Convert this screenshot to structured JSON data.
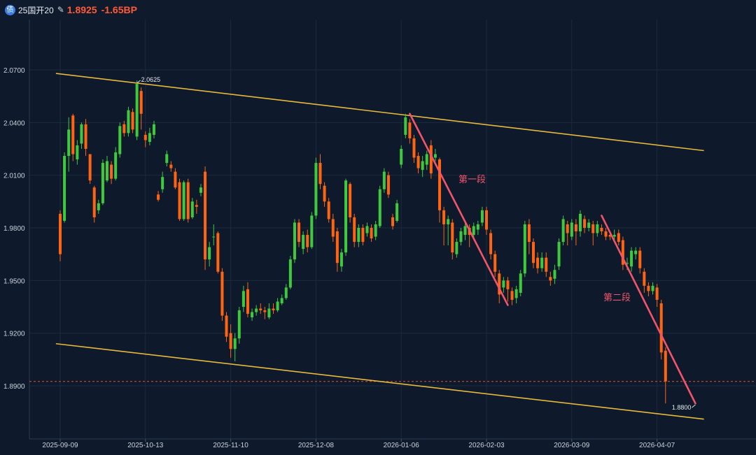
{
  "header": {
    "icon_glyph": "债",
    "bond_name": "25国开20",
    "price": "1.8925",
    "change": "-1.65BP",
    "accent": "#ff5a36"
  },
  "colors": {
    "background": "#0e1a2b",
    "grid": "#1b2a3e",
    "up": "#3ec93e",
    "down": "#ff6412",
    "channel": "#e6b93a",
    "trend": "#f2556b",
    "current_line": "#e0552f",
    "axis_text": "#c9d1dc"
  },
  "chart_data": {
    "type": "candlestick",
    "ylim": [
      1.863,
      2.094
    ],
    "yticks": [
      {
        "value": 2.07,
        "label": "2.0700"
      },
      {
        "value": 2.04,
        "label": "2.0400"
      },
      {
        "value": 2.01,
        "label": "2.0100"
      },
      {
        "value": 1.98,
        "label": "1.9800"
      },
      {
        "value": 1.95,
        "label": "1.9500"
      },
      {
        "value": 1.92,
        "label": "1.9200"
      },
      {
        "value": 1.89,
        "label": "1.8900"
      }
    ],
    "xticks": [
      {
        "index": 0,
        "label": "2025-09-09"
      },
      {
        "index": 20,
        "label": "2025-10-13"
      },
      {
        "index": 40,
        "label": "2025-11-10"
      },
      {
        "index": 60,
        "label": "2025-12-08"
      },
      {
        "index": 80,
        "label": "2026-01-06"
      },
      {
        "index": 100,
        "label": "2026-02-03"
      },
      {
        "index": 120,
        "label": "2026-03-09"
      },
      {
        "index": 140,
        "label": "2026-04-07"
      }
    ],
    "x_count": 151,
    "candles": [
      [
        1.988,
        1.965,
        1.99,
        1.961
      ],
      [
        1.984,
        2.021,
        2.023,
        1.983
      ],
      [
        2.021,
        2.036,
        2.043,
        2.012
      ],
      [
        2.044,
        2.022,
        2.045,
        2.018
      ],
      [
        2.019,
        2.027,
        2.03,
        2.016
      ],
      [
        2.028,
        2.039,
        2.04,
        2.025
      ],
      [
        2.039,
        2.025,
        2.042,
        2.021
      ],
      [
        2.022,
        2.007,
        2.022,
        2.005
      ],
      [
        2.003,
        1.986,
        2.004,
        1.983
      ],
      [
        1.99,
        1.994,
        1.996,
        1.988
      ],
      [
        1.994,
        2.017,
        2.019,
        1.993
      ],
      [
        2.007,
        2.018,
        2.021,
        2.006
      ],
      [
        2.016,
        2.008,
        2.018,
        2.005
      ],
      [
        2.008,
        2.023,
        2.026,
        2.007
      ],
      [
        2.022,
        2.038,
        2.04,
        2.02
      ],
      [
        2.039,
        2.034,
        2.041,
        2.032
      ],
      [
        2.034,
        2.047,
        2.049,
        2.032
      ],
      [
        2.046,
        2.036,
        2.048,
        2.034
      ],
      [
        2.032,
        2.062,
        2.064,
        2.03
      ],
      [
        2.058,
        2.045,
        2.06,
        2.036
      ],
      [
        2.033,
        2.03,
        2.035,
        2.026
      ],
      [
        2.029,
        2.034,
        2.037,
        2.027
      ],
      [
        2.033,
        2.039,
        2.041,
        2.031
      ],
      [
        1.999,
        1.996,
        2.001,
        1.995
      ],
      [
        2.002,
        2.009,
        2.012,
        2.0
      ],
      [
        2.017,
        2.022,
        2.024,
        2.015
      ],
      [
        2.016,
        2.014,
        2.018,
        2.012
      ],
      [
        2.012,
        2.003,
        2.014,
        2.002
      ],
      [
        2.006,
        1.985,
        2.008,
        1.984
      ],
      [
        1.985,
        2.006,
        2.007,
        1.984
      ],
      [
        2.006,
        1.985,
        2.008,
        1.983
      ],
      [
        1.986,
        1.995,
        1.997,
        1.985
      ],
      [
        1.993,
        1.992,
        1.996,
        1.988
      ],
      [
        2.0,
        2.003,
        2.005,
        1.998
      ],
      [
        2.012,
        1.962,
        2.015,
        1.956
      ],
      [
        1.962,
        1.969,
        1.972,
        1.958
      ],
      [
        1.975,
        1.975,
        1.982,
        1.97
      ],
      [
        1.977,
        1.955,
        1.978,
        1.954
      ],
      [
        1.955,
        1.93,
        1.957,
        1.927
      ],
      [
        1.93,
        1.918,
        1.932,
        1.915
      ],
      [
        1.92,
        1.911,
        1.925,
        1.906
      ],
      [
        1.911,
        1.917,
        1.92,
        1.904
      ],
      [
        1.917,
        1.933,
        1.935,
        1.914
      ],
      [
        1.935,
        1.944,
        1.947,
        1.932
      ],
      [
        1.945,
        1.931,
        1.949,
        1.929
      ],
      [
        1.929,
        1.932,
        1.934,
        1.927
      ],
      [
        1.932,
        1.934,
        1.936,
        1.93
      ],
      [
        1.934,
        1.933,
        1.937,
        1.931
      ],
      [
        1.933,
        1.932,
        1.935,
        1.928
      ],
      [
        1.929,
        1.934,
        1.937,
        1.928
      ],
      [
        1.934,
        1.933,
        1.937,
        1.931
      ],
      [
        1.933,
        1.938,
        1.94,
        1.932
      ],
      [
        1.937,
        1.94,
        1.942,
        1.936
      ],
      [
        1.94,
        1.946,
        1.948,
        1.939
      ],
      [
        1.946,
        1.962,
        1.964,
        1.945
      ],
      [
        1.962,
        1.983,
        1.985,
        1.96
      ],
      [
        1.983,
        1.972,
        1.985,
        1.969
      ],
      [
        1.968,
        1.976,
        1.978,
        1.965
      ],
      [
        1.976,
        1.969,
        1.979,
        1.966
      ],
      [
        1.969,
        1.987,
        1.989,
        1.968
      ],
      [
        1.987,
        2.017,
        2.02,
        1.985
      ],
      [
        2.017,
        2.005,
        2.022,
        2.002
      ],
      [
        2.004,
        1.995,
        2.006,
        1.992
      ],
      [
        1.995,
        1.985,
        1.997,
        1.983
      ],
      [
        1.985,
        1.975,
        1.988,
        1.972
      ],
      [
        1.978,
        1.96,
        1.98,
        1.955
      ],
      [
        1.958,
        1.966,
        1.968,
        1.955
      ],
      [
        1.966,
        2.007,
        2.008,
        1.964
      ],
      [
        2.005,
        1.986,
        2.006,
        1.983
      ],
      [
        1.986,
        1.972,
        1.988,
        1.969
      ],
      [
        1.972,
        1.98,
        1.982,
        1.969
      ],
      [
        1.98,
        1.972,
        1.982,
        1.97
      ],
      [
        1.977,
        1.981,
        1.983,
        1.975
      ],
      [
        1.98,
        1.974,
        1.982,
        1.972
      ],
      [
        1.975,
        1.982,
        1.984,
        1.973
      ],
      [
        1.981,
        2.002,
        2.004,
        1.98
      ],
      [
        2.002,
        2.012,
        2.014,
        2.0
      ],
      [
        2.01,
        1.999,
        2.012,
        1.997
      ],
      [
        1.986,
        1.981,
        1.988,
        1.979
      ],
      [
        1.984,
        1.994,
        1.996,
        1.983
      ],
      [
        2.016,
        2.025,
        2.027,
        2.014
      ],
      [
        2.033,
        2.043,
        2.045,
        2.031
      ],
      [
        2.04,
        2.031,
        2.042,
        2.028
      ],
      [
        2.031,
        2.02,
        2.033,
        2.017
      ],
      [
        2.021,
        2.014,
        2.023,
        2.011
      ],
      [
        2.013,
        2.018,
        2.021,
        2.009
      ],
      [
        2.016,
        2.022,
        2.024,
        2.013
      ],
      [
        2.027,
        2.011,
        2.03,
        2.008
      ],
      [
        2.02,
        2.022,
        2.025,
        2.018
      ],
      [
        2.019,
        1.99,
        2.02,
        1.983
      ],
      [
        1.99,
        1.982,
        1.992,
        1.97
      ],
      [
        1.982,
        1.985,
        1.987,
        1.97
      ],
      [
        1.983,
        1.966,
        1.985,
        1.962
      ],
      [
        1.965,
        1.972,
        1.974,
        1.963
      ],
      [
        1.972,
        1.978,
        1.98,
        1.97
      ],
      [
        1.976,
        1.981,
        1.983,
        1.973
      ],
      [
        1.98,
        1.976,
        1.982,
        1.969
      ],
      [
        1.976,
        1.981,
        1.983,
        1.974
      ],
      [
        1.979,
        1.982,
        1.984,
        1.976
      ],
      [
        1.983,
        1.99,
        1.992,
        1.981
      ],
      [
        1.99,
        1.979,
        1.992,
        1.976
      ],
      [
        1.977,
        1.965,
        1.979,
        1.962
      ],
      [
        1.965,
        1.955,
        1.967,
        1.952
      ],
      [
        1.954,
        1.942,
        1.956,
        1.937
      ],
      [
        1.946,
        1.95,
        1.952,
        1.943
      ],
      [
        1.95,
        1.945,
        1.952,
        1.938
      ],
      [
        1.944,
        1.939,
        1.946,
        1.936
      ],
      [
        1.94,
        1.945,
        1.947,
        1.937
      ],
      [
        1.943,
        1.954,
        1.956,
        1.941
      ],
      [
        1.954,
        1.982,
        1.984,
        1.952
      ],
      [
        1.982,
        1.972,
        1.985,
        1.965
      ],
      [
        1.972,
        1.96,
        1.974,
        1.957
      ],
      [
        1.963,
        1.957,
        1.966,
        1.954
      ],
      [
        1.957,
        1.963,
        1.966,
        1.955
      ],
      [
        1.963,
        1.955,
        1.966,
        1.952
      ],
      [
        1.952,
        1.95,
        1.955,
        1.947
      ],
      [
        1.951,
        1.956,
        1.959,
        1.948
      ],
      [
        1.958,
        1.972,
        1.974,
        1.956
      ],
      [
        1.972,
        1.985,
        1.987,
        1.97
      ],
      [
        1.982,
        1.977,
        1.984,
        1.97
      ],
      [
        1.975,
        1.983,
        1.985,
        1.973
      ],
      [
        1.982,
        1.978,
        1.985,
        1.97
      ],
      [
        1.978,
        1.988,
        1.99,
        1.975
      ],
      [
        1.985,
        1.98,
        1.987,
        1.977
      ],
      [
        1.98,
        1.983,
        1.985,
        1.978
      ],
      [
        1.982,
        1.977,
        1.984,
        1.97
      ],
      [
        1.977,
        1.982,
        1.984,
        1.975
      ],
      [
        1.98,
        1.978,
        1.982,
        1.976
      ],
      [
        1.978,
        1.975,
        1.98,
        1.973
      ],
      [
        1.976,
        1.975,
        1.978,
        1.973
      ],
      [
        1.975,
        1.976,
        1.979,
        1.973
      ],
      [
        1.977,
        1.972,
        1.979,
        1.97
      ],
      [
        1.973,
        1.959,
        1.975,
        1.956
      ],
      [
        1.96,
        1.96,
        1.963,
        1.956
      ],
      [
        1.958,
        1.967,
        1.969,
        1.955
      ],
      [
        1.965,
        1.967,
        1.969,
        1.962
      ],
      [
        1.967,
        1.957,
        1.969,
        1.954
      ],
      [
        1.955,
        1.947,
        1.957,
        1.943
      ],
      [
        1.947,
        1.944,
        1.949,
        1.941
      ],
      [
        1.944,
        1.947,
        1.949,
        1.942
      ],
      [
        1.946,
        1.939,
        1.948,
        1.935
      ],
      [
        1.937,
        1.909,
        1.939,
        1.905
      ],
      [
        1.91,
        1.8925,
        1.912,
        1.88
      ]
    ],
    "channel_lines": [
      {
        "x1": -1,
        "y1": 2.068,
        "x2": 151,
        "y2": 2.024
      },
      {
        "x1": -1,
        "y1": 1.914,
        "x2": 151,
        "y2": 1.871
      }
    ],
    "trend_lines": [
      {
        "x1": 82,
        "y1": 2.045,
        "x2": 105,
        "y2": 1.936,
        "label": "第一段"
      },
      {
        "x1": 127,
        "y1": 1.987,
        "x2": 149,
        "y2": 1.88,
        "label": "第二段"
      }
    ],
    "annotations": [
      {
        "index": 18,
        "value": 2.0625,
        "label": "2.0625"
      },
      {
        "index": 149,
        "value": 1.88,
        "label": "1.8800"
      }
    ],
    "current_value": 1.8925
  }
}
